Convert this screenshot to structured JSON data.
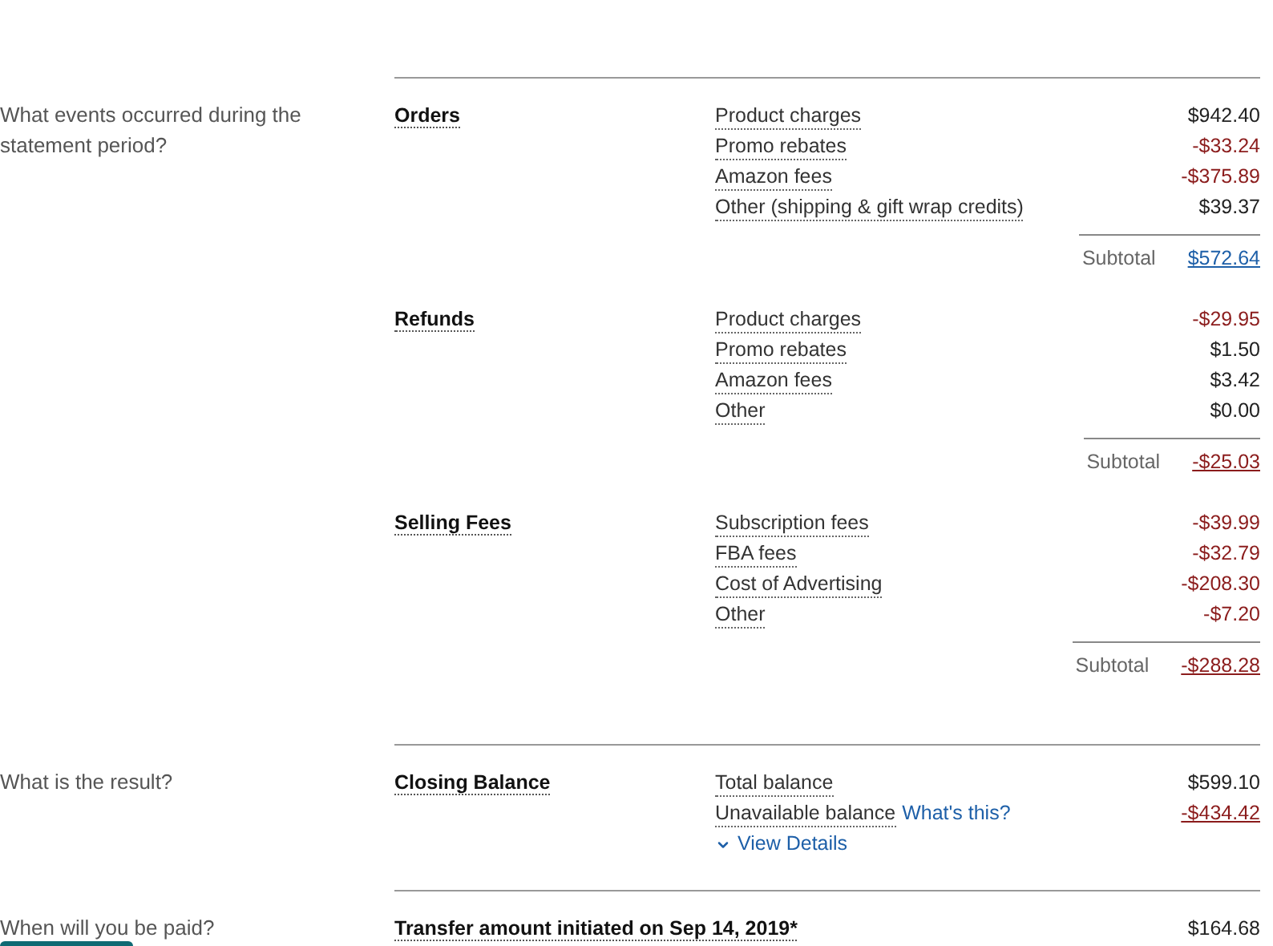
{
  "groups": [
    {
      "question": "What events occurred during the statement period?",
      "sections": [
        {
          "title": "Orders",
          "items": [
            {
              "label": "Product charges",
              "amount": "$942.40",
              "negative": false
            },
            {
              "label": "Promo rebates",
              "amount": "-$33.24",
              "negative": true
            },
            {
              "label": "Amazon fees",
              "amount": "-$375.89",
              "negative": true
            },
            {
              "label": "Other (shipping & gift wrap credits)",
              "amount": "$39.37",
              "negative": false
            }
          ],
          "subtotal": {
            "label": "Subtotal",
            "amount": "$572.64",
            "negative": false
          }
        },
        {
          "title": "Refunds",
          "items": [
            {
              "label": "Product charges",
              "amount": "-$29.95",
              "negative": true
            },
            {
              "label": "Promo rebates",
              "amount": "$1.50",
              "negative": false
            },
            {
              "label": "Amazon fees",
              "amount": "$3.42",
              "negative": false
            },
            {
              "label": "Other",
              "amount": "$0.00",
              "negative": false
            }
          ],
          "subtotal": {
            "label": "Subtotal",
            "amount": "-$25.03",
            "negative": true
          }
        },
        {
          "title": "Selling Fees",
          "items": [
            {
              "label": "Subscription fees",
              "amount": "-$39.99",
              "negative": true
            },
            {
              "label": "FBA fees",
              "amount": "-$32.79",
              "negative": true
            },
            {
              "label": "Cost of Advertising",
              "amount": "-$208.30",
              "negative": true
            },
            {
              "label": "Other",
              "amount": "-$7.20",
              "negative": true
            }
          ],
          "subtotal": {
            "label": "Subtotal",
            "amount": "-$288.28",
            "negative": true
          }
        }
      ]
    },
    {
      "question": "What is the result?",
      "sections": [
        {
          "title": "Closing Balance",
          "items": [
            {
              "label": "Total balance",
              "amount": "$599.10",
              "negative": false
            },
            {
              "label": "Unavailable balance",
              "link": "What's this?",
              "amount": "-$434.42",
              "negative": true,
              "underlined": true
            }
          ],
          "expander": {
            "label": "View Details",
            "expanded": false
          }
        }
      ]
    },
    {
      "question": "When will you be paid?",
      "button": true,
      "sections": [
        {
          "title": "Transfer amount initiated on Sep 14, 2019*",
          "amount": "$164.68",
          "negative": false
        }
      ]
    }
  ]
}
